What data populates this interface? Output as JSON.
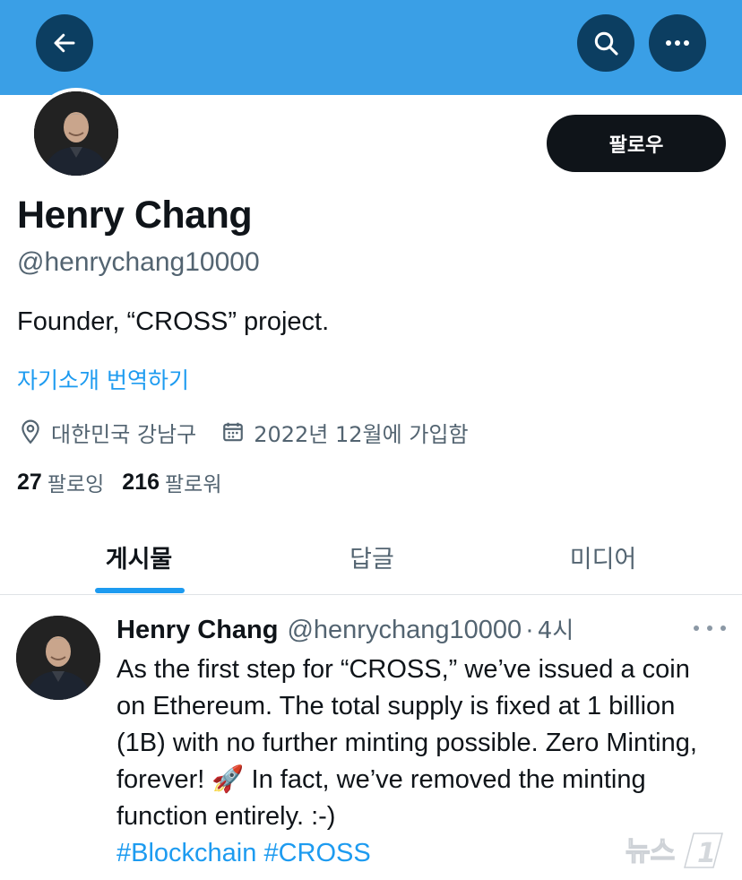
{
  "header": {
    "back_icon": "arrow-left-icon",
    "search_icon": "search-icon",
    "more_icon": "more-horizontal-icon",
    "banner_color": "#3a9fe6",
    "button_color": "#0c3e61"
  },
  "profile": {
    "follow_label": "팔로우",
    "name": "Henry Chang",
    "handle": "@henrychang10000",
    "bio": "Founder, “CROSS” project.",
    "translate_link": "자기소개 번역하기",
    "location": "대한민국 강남구",
    "joined": "2022년 12월에 가입함",
    "following_count": "27",
    "following_label": "팔로잉",
    "followers_count": "216",
    "followers_label": "팔로워",
    "location_icon": "location-pin-icon",
    "calendar_icon": "calendar-icon"
  },
  "tabs": [
    {
      "label": "게시물",
      "active": true
    },
    {
      "label": "답글",
      "active": false
    },
    {
      "label": "미디어",
      "active": false
    }
  ],
  "tweet": {
    "name": "Henry Chang",
    "handle": "@henrychang10000",
    "separator": "·",
    "time": "4시",
    "text_part1": "As the first step for “CROSS,” we’ve issued a coin on Ethereum. The total supply is fixed at 1 billion (1B) with no further minting possible. Zero Minting, forever! ",
    "emoji": "🚀",
    "text_part2": " In fact, we’ve removed the minting function entirely. :-)",
    "hashtag1": "#Blockchain",
    "hashtag2": "#CROSS"
  },
  "watermark": {
    "text": "뉴스1"
  },
  "colors": {
    "accent": "#1d9bf0",
    "text_primary": "#0f1419",
    "text_secondary": "#536471"
  }
}
